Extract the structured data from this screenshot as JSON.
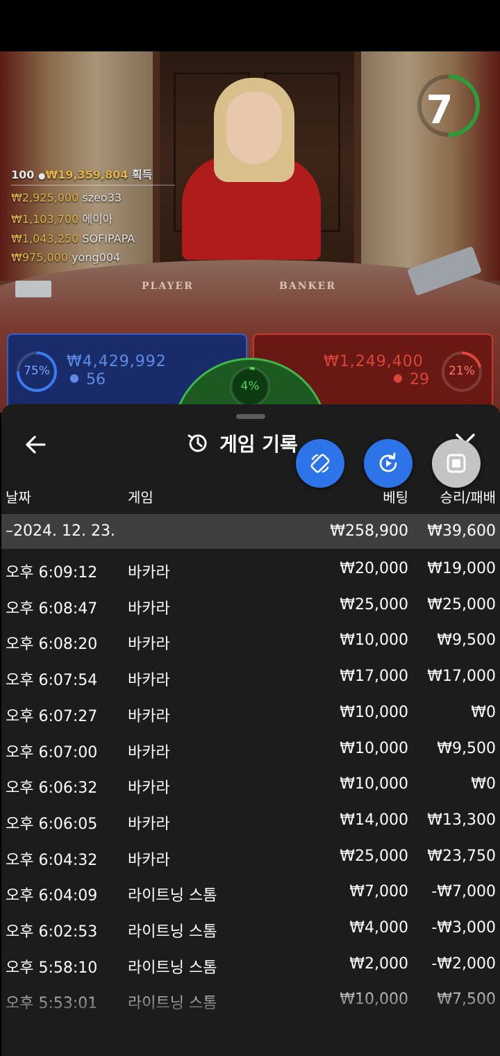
{
  "leaderboard": {
    "count": "100",
    "total_amount": "₩19,359,804",
    "total_suffix": "획득",
    "rows": [
      {
        "amount": "₩2,925,000",
        "name": "szeo33"
      },
      {
        "amount": "₩1,103,700",
        "name": "에이아"
      },
      {
        "amount": "₩1,043,250",
        "name": "SOFIPAPA"
      },
      {
        "amount": "₩975,000",
        "name": "yong004"
      }
    ]
  },
  "table": {
    "player_label": "PLAYER",
    "banker_label": "BANKER"
  },
  "timer": {
    "seconds": "7",
    "progress": 0.5,
    "color": "#2e9a3a"
  },
  "bets": {
    "player": {
      "percent": "75%",
      "percent_value": 0.75,
      "amount": "₩4,429,992",
      "count": "56",
      "color": "#3a5cc8"
    },
    "tie": {
      "percent": "4%",
      "percent_value": 0.04,
      "color": "#3fb84a"
    },
    "banker": {
      "percent": "21%",
      "percent_value": 0.21,
      "amount": "₩1,249,400",
      "count": "29",
      "color": "#c8382e"
    }
  },
  "sheet": {
    "title": "게임 기록",
    "columns": {
      "date": "날짜",
      "game": "게임",
      "bet": "베팅",
      "result": "승리/패배"
    },
    "date_group": {
      "label": "–2024. 12. 23.",
      "bet_total": "₩258,900",
      "result_total": "₩39,600"
    },
    "rows": [
      {
        "time": "오후 6:09:12",
        "game": "바카라",
        "bet": "₩20,000",
        "result": "₩19,000"
      },
      {
        "time": "오후 6:08:47",
        "game": "바카라",
        "bet": "₩25,000",
        "result": "₩25,000"
      },
      {
        "time": "오후 6:08:20",
        "game": "바카라",
        "bet": "₩10,000",
        "result": "₩9,500"
      },
      {
        "time": "오후 6:07:54",
        "game": "바카라",
        "bet": "₩17,000",
        "result": "₩17,000"
      },
      {
        "time": "오후 6:07:27",
        "game": "바카라",
        "bet": "₩10,000",
        "result": "₩0"
      },
      {
        "time": "오후 6:07:00",
        "game": "바카라",
        "bet": "₩10,000",
        "result": "₩9,500"
      },
      {
        "time": "오후 6:06:32",
        "game": "바카라",
        "bet": "₩10,000",
        "result": "₩0"
      },
      {
        "time": "오후 6:06:05",
        "game": "바카라",
        "bet": "₩14,000",
        "result": "₩13,300"
      },
      {
        "time": "오후 6:04:32",
        "game": "바카라",
        "bet": "₩25,000",
        "result": "₩23,750"
      },
      {
        "time": "오후 6:04:09",
        "game": "라이트닝 스톰",
        "bet": "₩7,000",
        "result": "-₩7,000"
      },
      {
        "time": "오후 6:02:53",
        "game": "라이트닝 스톰",
        "bet": "₩4,000",
        "result": "-₩3,000"
      },
      {
        "time": "오후 5:58:10",
        "game": "라이트닝 스톰",
        "bet": "₩2,000",
        "result": "-₩2,000"
      },
      {
        "time": "오후 5:53:01",
        "game": "라이트닝 스톰",
        "bet": "₩10,000",
        "result": "₩7,500"
      }
    ]
  },
  "icons": {
    "back": "arrow-left-icon",
    "history": "history-icon",
    "close": "close-icon",
    "fab1": "rotate-device-icon",
    "fab2": "replay-icon",
    "fab3": "stop-icon"
  },
  "colors": {
    "fab_blue": "#2c74e8",
    "fab_grey": "#c4c4c4",
    "sheet_bg": "#1c1c1c",
    "date_row_bg": "#3e3e3e"
  }
}
